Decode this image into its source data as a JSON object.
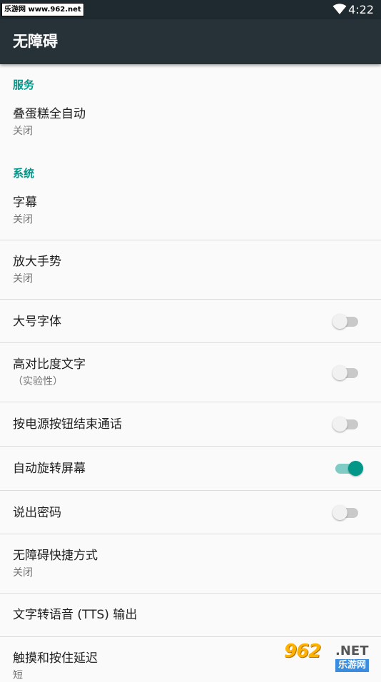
{
  "status_bar": {
    "watermark": "乐游网 www.962.net",
    "time": "4:22"
  },
  "app_bar": {
    "title": "无障碍"
  },
  "sections": {
    "services": {
      "header": "服务",
      "items": [
        {
          "title": "叠蛋糕全自动",
          "summary": "关闭"
        }
      ]
    },
    "system": {
      "header": "系统",
      "items": [
        {
          "title": "字幕",
          "summary": "关闭"
        },
        {
          "title": "放大手势",
          "summary": "关闭"
        },
        {
          "title": "大号字体",
          "switch_on": false
        },
        {
          "title": "高对比度文字",
          "summary": "（实验性）",
          "switch_on": false
        },
        {
          "title": "按电源按钮结束通话",
          "switch_on": false
        },
        {
          "title": "自动旋转屏幕",
          "switch_on": true
        },
        {
          "title": "说出密码",
          "switch_on": false
        },
        {
          "title": "无障碍快捷方式",
          "summary": "关闭"
        },
        {
          "title": "文字转语音 (TTS) 输出"
        },
        {
          "title": "触摸和按住延迟",
          "summary": "短"
        }
      ]
    }
  },
  "watermark": {
    "logo": "962",
    "net": ".NET",
    "sub": "乐游网"
  },
  "colors": {
    "accent": "#009688",
    "app_bar": "#263238",
    "status_bar": "#1f2a30",
    "background": "#fafafa"
  }
}
